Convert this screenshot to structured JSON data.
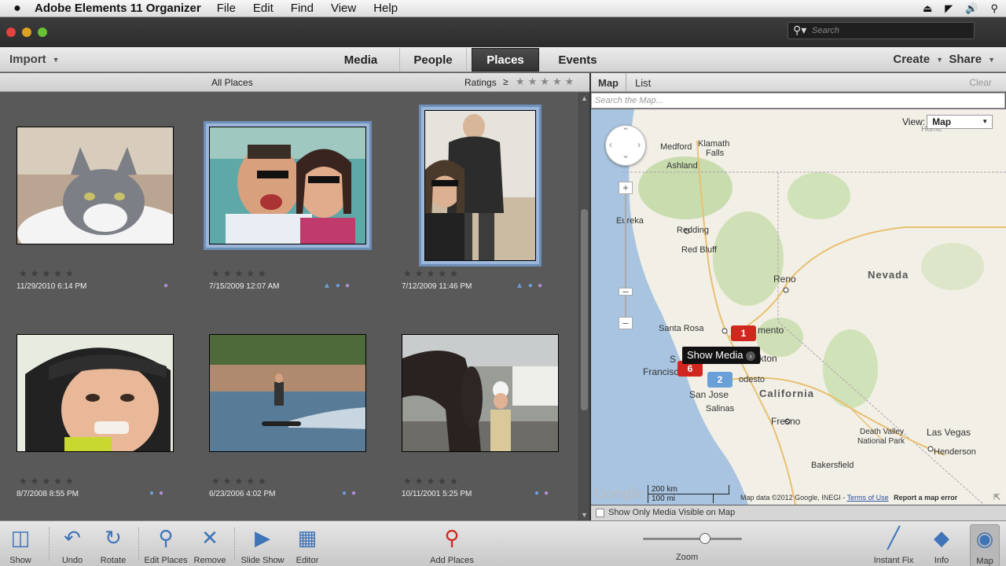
{
  "menubar": {
    "apple": "",
    "app_name": "Adobe Elements 11 Organizer",
    "items": [
      "File",
      "Edit",
      "Find",
      "View",
      "Help"
    ]
  },
  "titlebar": {
    "search_placeholder": "Search"
  },
  "tabs": {
    "import": "Import",
    "items": [
      "Media",
      "People",
      "Places",
      "Events"
    ],
    "active": "Places",
    "create": "Create",
    "share": "Share"
  },
  "left_header": {
    "all_places": "All Places",
    "ratings": "Ratings",
    "ratings_op": "≥"
  },
  "photos": [
    {
      "date": "11/29/2010 6:14 PM",
      "selected": false,
      "subject": "cat"
    },
    {
      "date": "7/15/2009 12:07 AM",
      "selected": true,
      "subject": "couple-boat"
    },
    {
      "date": "7/12/2009 11:46 PM",
      "selected": true,
      "subject": "beach-pair"
    },
    {
      "date": "8/7/2008 8:55 PM",
      "selected": false,
      "subject": "helmet-face"
    },
    {
      "date": "6/23/2006 4:02 PM",
      "selected": false,
      "subject": "wakeboard"
    },
    {
      "date": "10/11/2001 5:25 PM",
      "selected": false,
      "subject": "horse"
    }
  ],
  "right_header": {
    "map_tab": "Map",
    "list_tab": "List",
    "clear": "Clear",
    "search_placeholder": "Search the Map..."
  },
  "map": {
    "view_label": "View:",
    "view_value": "Map",
    "labels": {
      "medford": "Medford",
      "klamath": "Klamath",
      "falls": "Falls",
      "ashland": "Ashland",
      "eureka": "Eureka",
      "redding": "Redding",
      "red_bluff": "Red Bluff",
      "reno": "Reno",
      "nevada": "Nevada",
      "santa_rosa": "Santa Rosa",
      "sacramento": "mento",
      "stockton": "kton",
      "francisco": "Francisco",
      "modesto": "odesto",
      "san_jose": "San Jose",
      "salinas": "Salinas",
      "california": "California",
      "fresno": "Fresno",
      "death_valley": "Death Valley",
      "national_park": "National Park",
      "las_vegas": "Las Vegas",
      "henderson": "Henderson",
      "bakersfield": "Bakersfield",
      "home": "Home",
      "s": "S"
    },
    "pins": [
      {
        "count": "1",
        "color": "#d0281e"
      },
      {
        "count": "6",
        "color": "#d0281e"
      },
      {
        "count": "2",
        "color": "#6aa0d8"
      }
    ],
    "tooltip": "Show Media",
    "scale_km": "200 km",
    "scale_mi": "100 mi",
    "google": "Google",
    "attribution": "Map data ©2012 Google, INEGI",
    "terms": "Terms of Use",
    "report": "Report a map error",
    "show_only": "Show Only Media Visible on Map"
  },
  "toolbar": {
    "show_pane": "Show Pane",
    "undo": "Undo",
    "rotate": "Rotate",
    "edit_places": "Edit Places",
    "remove": "Remove",
    "slide_show": "Slide Show",
    "editor": "Editor",
    "add_places": "Add Places",
    "zoom": "Zoom",
    "instant_fix": "Instant Fix",
    "info": "Info",
    "map": "Map",
    "zoom_level": 0.63
  },
  "colors": {
    "accent": "#3f74b8",
    "selection": "#6d8fb8",
    "pin_red": "#d0281e",
    "pin_blue": "#6aa0d8"
  }
}
